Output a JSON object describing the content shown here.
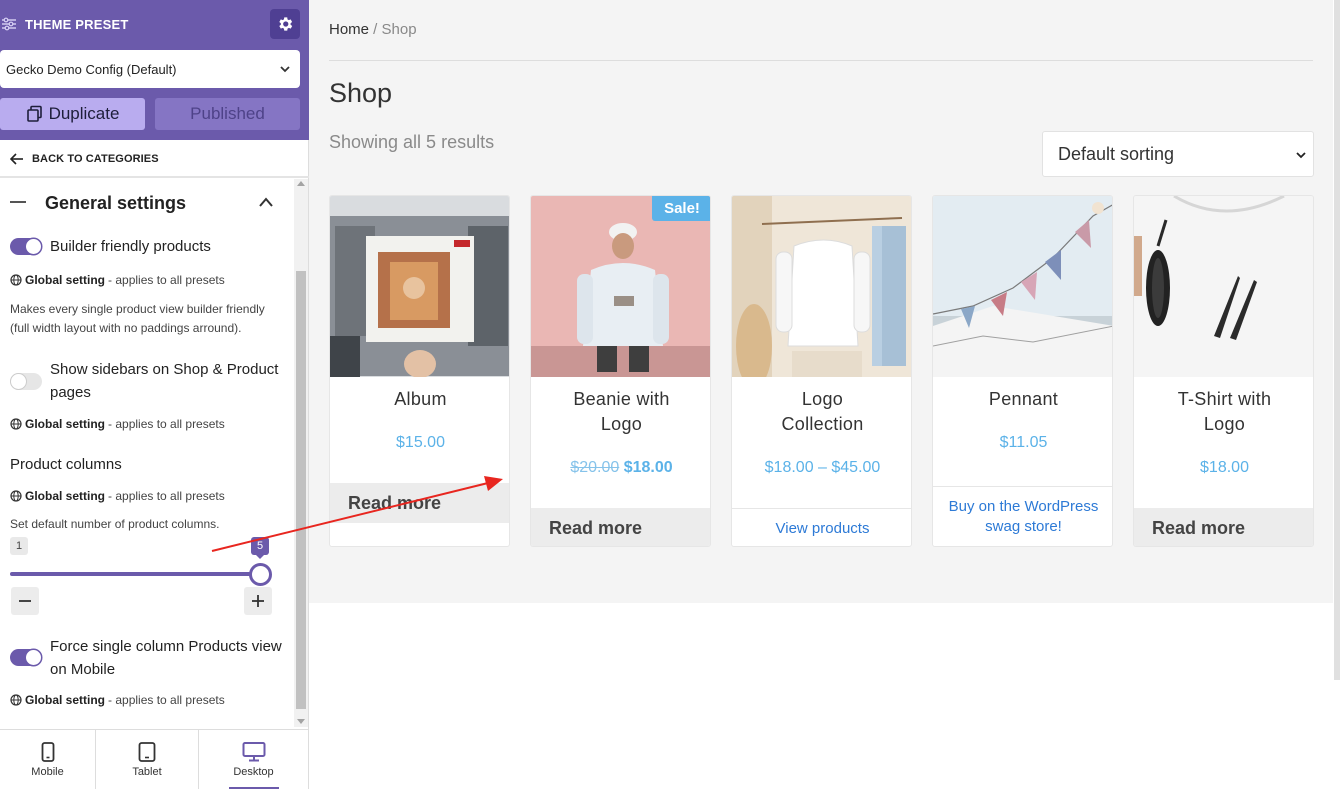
{
  "sidebar": {
    "header_title": "THEME PRESET",
    "preset_value": "Gecko Demo Config (Default)",
    "duplicate_label": "Duplicate",
    "published_label": "Published",
    "back_label": "BACK TO CATEGORIES",
    "section_title": "General settings",
    "global_bold": "Global setting",
    "global_rest": " - applies to all presets",
    "opt1_label": "Builder friendly products",
    "opt1_desc_line1": "Makes every single product view builder friendly",
    "opt1_desc_line2": "(full width layout with no paddings arround).",
    "opt2_label_line1": "Show sidebars on Shop & Product",
    "opt2_label_line2": "pages",
    "opt3_label": "Product columns",
    "opt3_desc": "Set default number of product columns.",
    "slider_min": "1",
    "slider_value": "5",
    "opt4_label_line1": "Force single column Products view",
    "opt4_label_line2": "on Mobile",
    "devices": [
      "Mobile",
      "Tablet",
      "Desktop"
    ],
    "accent_color": "#6b5aab"
  },
  "main": {
    "breadcrumb_home": "Home",
    "breadcrumb_sep": " / ",
    "breadcrumb_current": "Shop",
    "title": "Shop",
    "result_count": "Showing all 5 results",
    "sort_value": "Default sorting",
    "sale_badge": "Sale!",
    "products": [
      {
        "name_line1": "Album",
        "name_line2": "",
        "price": "$15.00",
        "button": "Read more"
      },
      {
        "name_line1": "Beanie with",
        "name_line2": "Logo",
        "old_price": "$20.00",
        "price": "$18.00",
        "button": "Read more"
      },
      {
        "name_line1": "Logo",
        "name_line2": "Collection",
        "price": "$18.00 – $45.00",
        "button": "View products"
      },
      {
        "name_line1": "Pennant",
        "name_line2": "",
        "price": "$11.05",
        "button_line1": "Buy on the WordPress",
        "button_line2": "swag store!"
      },
      {
        "name_line1": "T-Shirt with",
        "name_line2": "Logo",
        "price": "$18.00",
        "button": "Read more"
      }
    ],
    "price_color": "#5bb2e8",
    "link_color": "#2d7ad6"
  }
}
